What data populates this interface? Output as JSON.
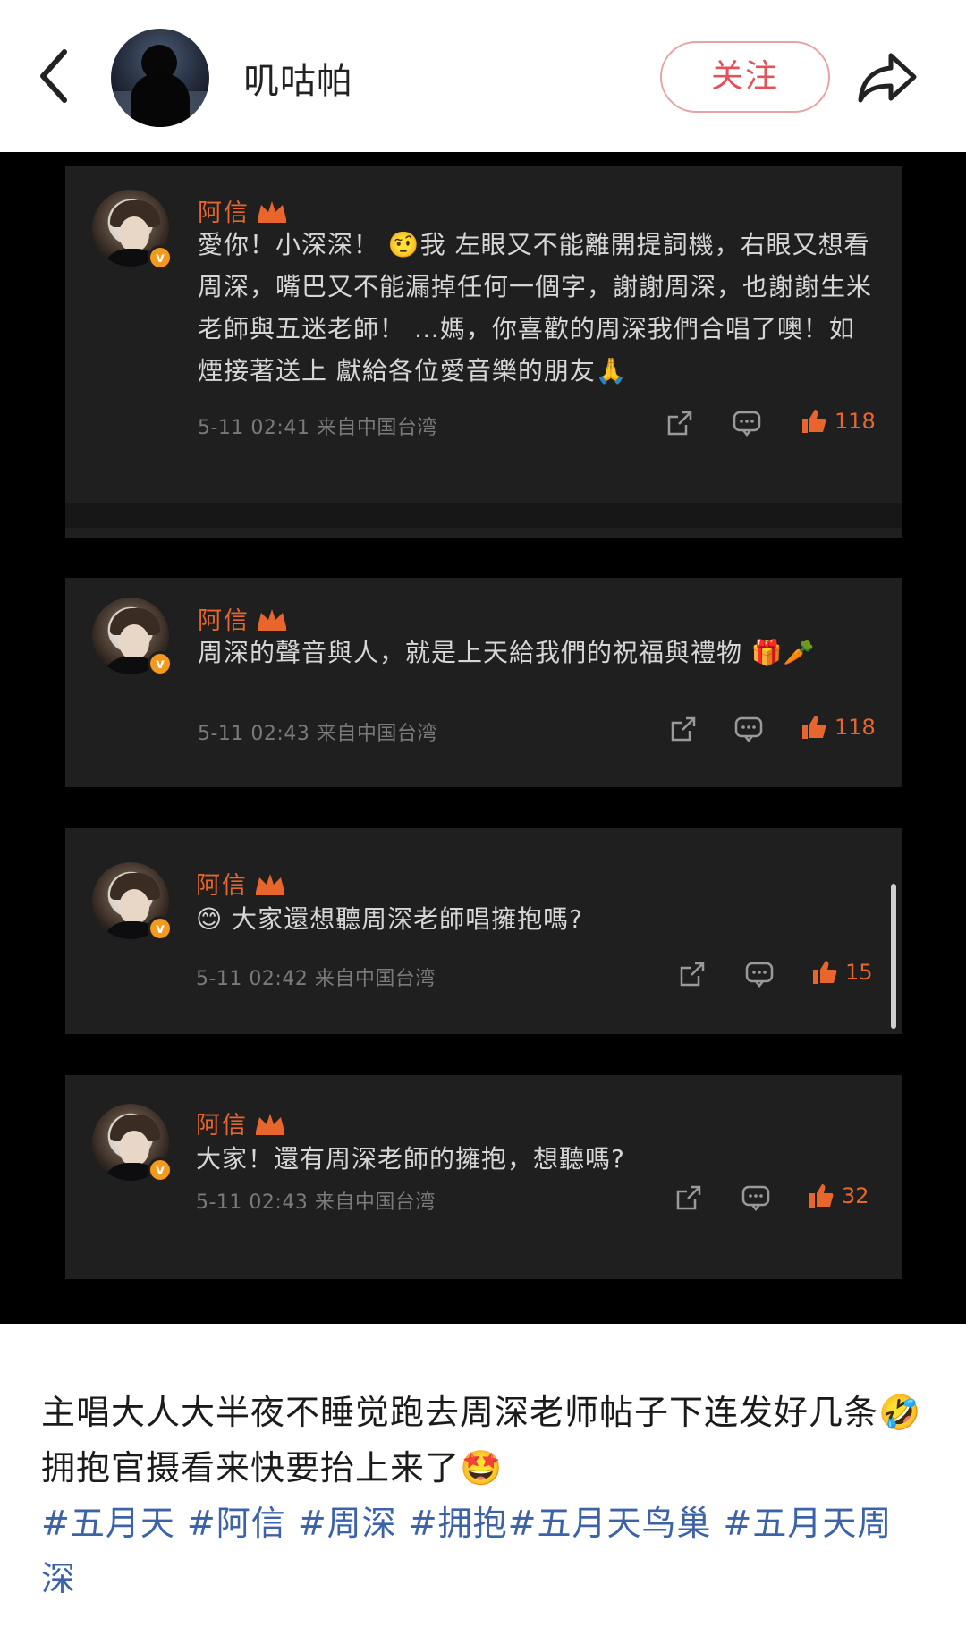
{
  "header": {
    "username": "叽咕帕",
    "follow_label": "关注"
  },
  "comments": [
    {
      "name": "阿信",
      "text": "愛你！小深深！ 🤨我 左眼又不能離開提詞機，右眼又想看周深，嘴巴又不能漏掉任何一個字，謝謝周深，也謝謝生米老師與五迷老師！ …媽，你喜歡的周深我們合唱了噢！如煙接著送上 獻給各位愛音樂的朋友🙏",
      "time": "5-11 02:41",
      "source": "来自中国台湾",
      "likes": "118"
    },
    {
      "name": "阿信",
      "text": "周深的聲音與人，就是上天給我們的祝福與禮物 🎁🥕",
      "time": "5-11 02:43",
      "source": "来自中国台湾",
      "likes": "118"
    },
    {
      "name": "阿信",
      "text": "😊 大家還想聽周深老師唱擁抱嗎?",
      "time": "5-11 02:42",
      "source": "来自中国台湾",
      "likes": "15"
    },
    {
      "name": "阿信",
      "text": "大家！還有周深老師的擁抱，想聽嗎?",
      "time": "5-11 02:43",
      "source": "来自中国台湾",
      "likes": "32"
    }
  ],
  "caption": {
    "text": "主唱大人大半夜不睡觉跑去周深老师帖子下连发好几条🤣拥抱官摄看来快要抬上来了🤩",
    "tags": "#五月天 #阿信 #周深 #拥抱#五月天鸟巢 #五月天周深"
  },
  "colors": {
    "accent": "#e8662e",
    "follow": "#e1535b",
    "tag": "#3c63a8",
    "card_bg": "#1f1f1f"
  },
  "icons": [
    "back-chevron-icon",
    "share-arrow-icon",
    "repost-icon",
    "comment-icon",
    "thumbs-up-icon",
    "crown-icon",
    "verified-badge-icon"
  ]
}
